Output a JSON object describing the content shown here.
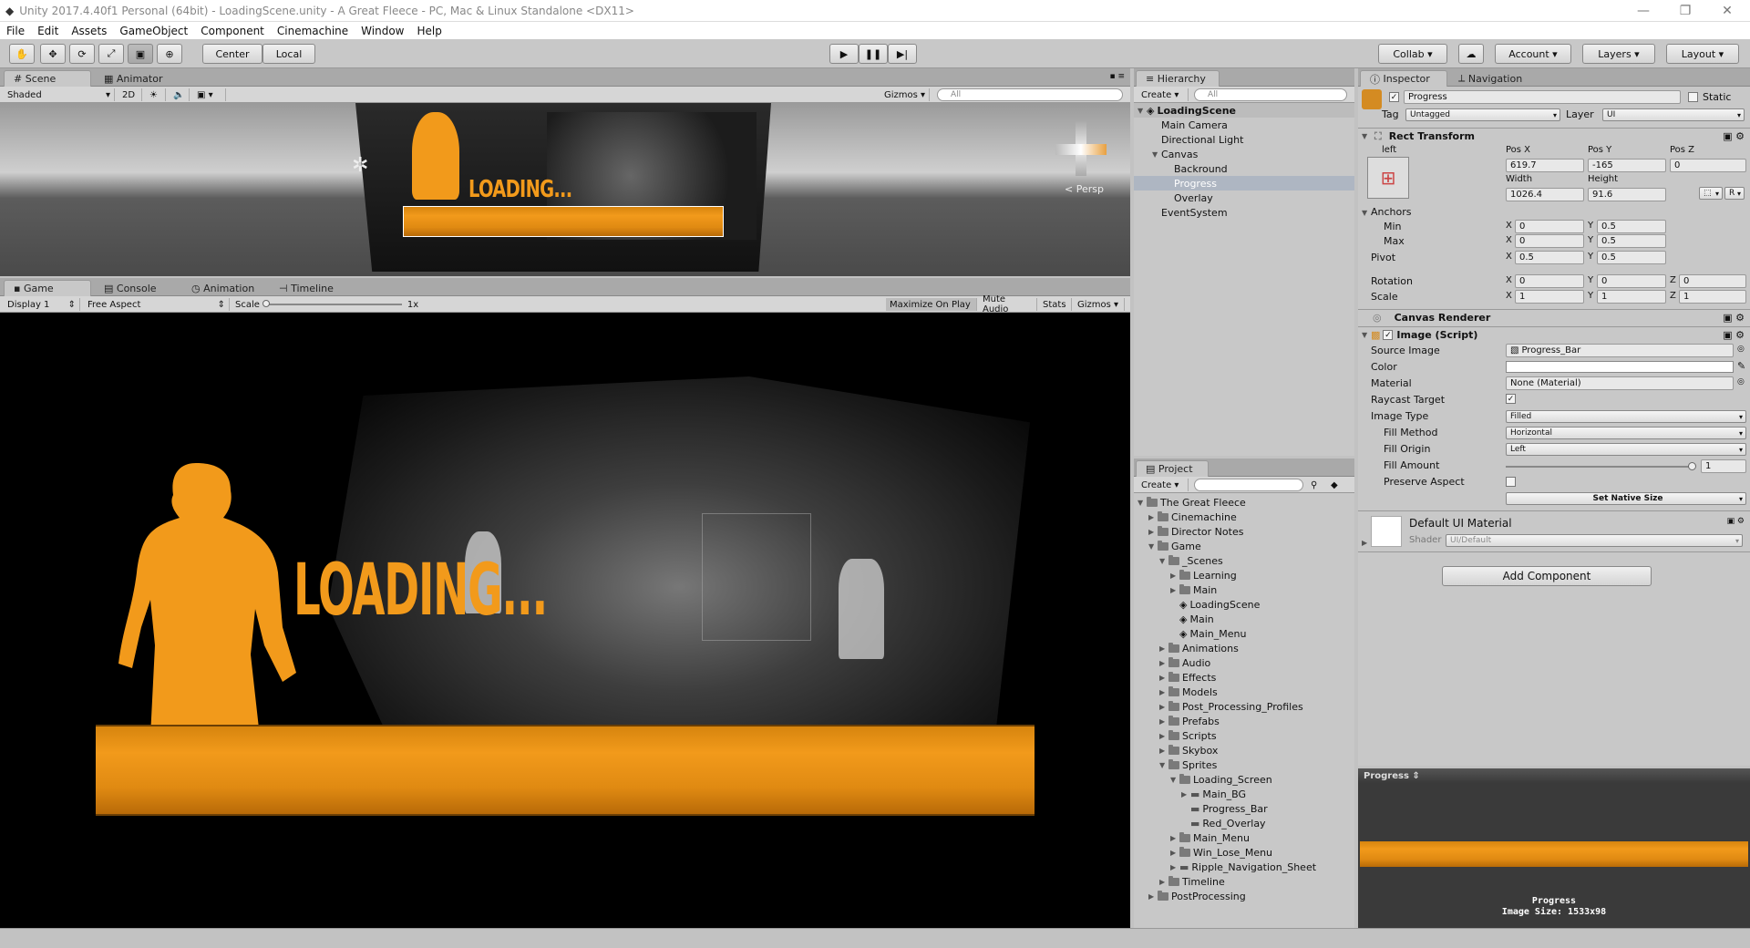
{
  "window": {
    "title": "Unity 2017.4.40f1 Personal (64bit) - LoadingScene.unity - A Great Fleece - PC, Mac & Linux Standalone <DX11>"
  },
  "menu": [
    "File",
    "Edit",
    "Assets",
    "GameObject",
    "Component",
    "Cinemachine",
    "Window",
    "Help"
  ],
  "toolbar": {
    "pivot": "Center",
    "space": "Local",
    "collab": "Collab",
    "account": "Account",
    "layers": "Layers",
    "layout": "Layout"
  },
  "scene": {
    "tab_scene": "Scene",
    "tab_animator": "Animator",
    "shading": "Shaded",
    "mode2d": "2D",
    "gizmos": "Gizmos",
    "search": "All",
    "persp": "Persp",
    "loading": "LOADING..."
  },
  "game": {
    "tab_game": "Game",
    "tab_console": "Console",
    "tab_animation": "Animation",
    "tab_timeline": "Timeline",
    "display": "Display 1",
    "aspect": "Free Aspect",
    "scale_label": "Scale",
    "scale_value": "1x",
    "maximize": "Maximize On Play",
    "mute": "Mute Audio",
    "stats": "Stats",
    "gizmos": "Gizmos",
    "loading": "LOADING..."
  },
  "hierarchy": {
    "tab": "Hierarchy",
    "create": "Create",
    "search": "All",
    "root": "LoadingScene",
    "items": [
      "Main Camera",
      "Directional Light",
      "Canvas",
      "Backround",
      "Progress",
      "Overlay",
      "EventSystem"
    ]
  },
  "project": {
    "tab": "Project",
    "create": "Create",
    "items": [
      "The Great Fleece",
      "Cinemachine",
      "Director Notes",
      "Game",
      "_Scenes",
      "Learning",
      "Main",
      "LoadingScene",
      "Main",
      "Main_Menu",
      "Animations",
      "Audio",
      "Effects",
      "Models",
      "Post_Processing_Profiles",
      "Prefabs",
      "Scripts",
      "Skybox",
      "Sprites",
      "Loading_Screen",
      "Main_BG",
      "Progress_Bar",
      "Red_Overlay",
      "Main_Menu",
      "Win_Lose_Menu",
      "Ripple_Navigation_Sheet",
      "Timeline",
      "PostProcessing"
    ]
  },
  "inspector": {
    "tab": "Inspector",
    "tab_nav": "Navigation",
    "name": "Progress",
    "static": "Static",
    "tag_label": "Tag",
    "tag": "Untagged",
    "layer_label": "Layer",
    "layer": "UI",
    "rect": {
      "title": "Rect Transform",
      "anchor_h": "left",
      "anchor_v": "middle",
      "posx_l": "Pos X",
      "posy_l": "Pos Y",
      "posz_l": "Pos Z",
      "posx": "619.7",
      "posy": "-165",
      "posz": "0",
      "width_l": "Width",
      "height_l": "Height",
      "width": "1026.4",
      "height": "91.6",
      "anchors": "Anchors",
      "min": "Min",
      "max": "Max",
      "minx": "0",
      "miny": "0.5",
      "maxx": "0",
      "maxy": "0.5",
      "pivot": "Pivot",
      "pivx": "0.5",
      "pivy": "0.5",
      "rotation": "Rotation",
      "rotx": "0",
      "roty": "0",
      "rotz": "0",
      "scale": "Scale",
      "sx": "1",
      "sy": "1",
      "sz": "1",
      "x": "X",
      "y": "Y",
      "z": "Z",
      "r": "R"
    },
    "canvas_renderer": "Canvas Renderer",
    "image": {
      "title": "Image (Script)",
      "source_l": "Source Image",
      "source": "Progress_Bar",
      "color_l": "Color",
      "material_l": "Material",
      "material": "None (Material)",
      "raycast_l": "Raycast Target",
      "type_l": "Image Type",
      "type": "Filled",
      "fill_method_l": "Fill Method",
      "fill_method": "Horizontal",
      "fill_origin_l": "Fill Origin",
      "fill_origin": "Left",
      "fill_amount_l": "Fill Amount",
      "fill_amount": "1",
      "preserve_l": "Preserve Aspect",
      "native": "Set Native Size"
    },
    "material": {
      "name": "Default UI Material",
      "shader_l": "Shader",
      "shader": "UI/Default"
    },
    "add_component": "Add Component",
    "preview": {
      "title": "Progress",
      "name": "Progress",
      "size": "Image Size: 1533x98"
    }
  },
  "colors": {
    "accent": "#f29a1b",
    "selection": "#aeb6c2"
  }
}
